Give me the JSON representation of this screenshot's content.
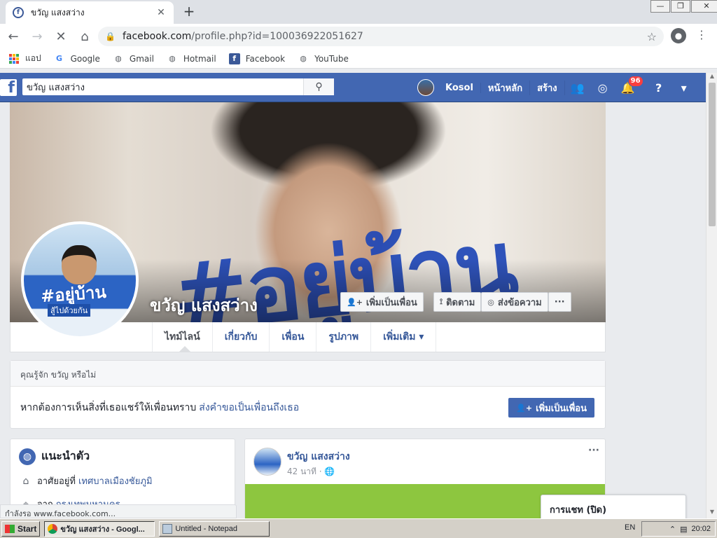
{
  "browser": {
    "tab_title": "ขวัญ แสงสว่าง",
    "tab_close": "✕",
    "new_tab": "+",
    "url_host": "facebook.com",
    "url_path": "/profile.php?id=100036922051627",
    "window_controls": [
      "—",
      "❐",
      "✕"
    ],
    "bookmarks": [
      {
        "label": "แอป",
        "icon": "apps-grid-icon"
      },
      {
        "label": "Google",
        "icon": "google-icon"
      },
      {
        "label": "Gmail",
        "icon": "globe-icon"
      },
      {
        "label": "Hotmail",
        "icon": "globe-icon"
      },
      {
        "label": "Facebook",
        "icon": "facebook-icon"
      },
      {
        "label": "YouTube",
        "icon": "globe-icon"
      }
    ],
    "status_text": "กำลังรอ www.facebook.com..."
  },
  "fb_header": {
    "search_value": "ขวัญ แสงสว่าง",
    "user_name": "Kosol",
    "nav_home": "หน้าหลัก",
    "nav_create": "สร้าง",
    "notification_count": "96"
  },
  "profile": {
    "name": "ขวัญ แสงสว่าง",
    "cover_text": "#อยู่บ้าน",
    "pic_text": "#อยู่บ้าน",
    "pic_sub": "สู้ไปด้วยกัน",
    "add_friend": "เพิ่มเป็นเพื่อน",
    "follow": "ติดตาม",
    "message": "ส่งข้อความ",
    "more": "···",
    "tabs": [
      "ไทม์ไลน์",
      "เกี่ยวกับ",
      "เพื่อน",
      "รูปภาพ",
      "เพิ่มเติม ▾"
    ]
  },
  "know_card": {
    "header": "คุณรู้จัก ขวัญ หรือไม่",
    "body": "หากต้องการเห็นสิ่งที่เธอแชร์ให้เพื่อนทราบ",
    "link": "ส่งคำขอเป็นเพื่อนถึงเธอ",
    "button": "เพิ่มเป็นเพื่อน"
  },
  "intro": {
    "title": "แนะนำตัว",
    "lives_label": "อาศัยอยู่ที่",
    "lives_value": "เทศบาลเมืองชัยภูมิ",
    "from_label": "จาก",
    "from_value": "กรุงเทพมหานคร"
  },
  "post": {
    "author": "ขวัญ แสงสว่าง",
    "time": "42 นาที · 🌐",
    "more": "···"
  },
  "chat": {
    "label": "การแชท (ปิด)"
  },
  "taskbar": {
    "start": "Start",
    "tasks": [
      {
        "label": "ขวัญ แสงสว่าง - Googl..."
      },
      {
        "label": "Untitled - Notepad"
      }
    ],
    "lang": "EN",
    "time": "20:02"
  },
  "colors": {
    "fb_blue": "#4267b2",
    "fb_link": "#365899",
    "notif_red": "#fa3e3e",
    "post_green": "#8dc63f"
  }
}
